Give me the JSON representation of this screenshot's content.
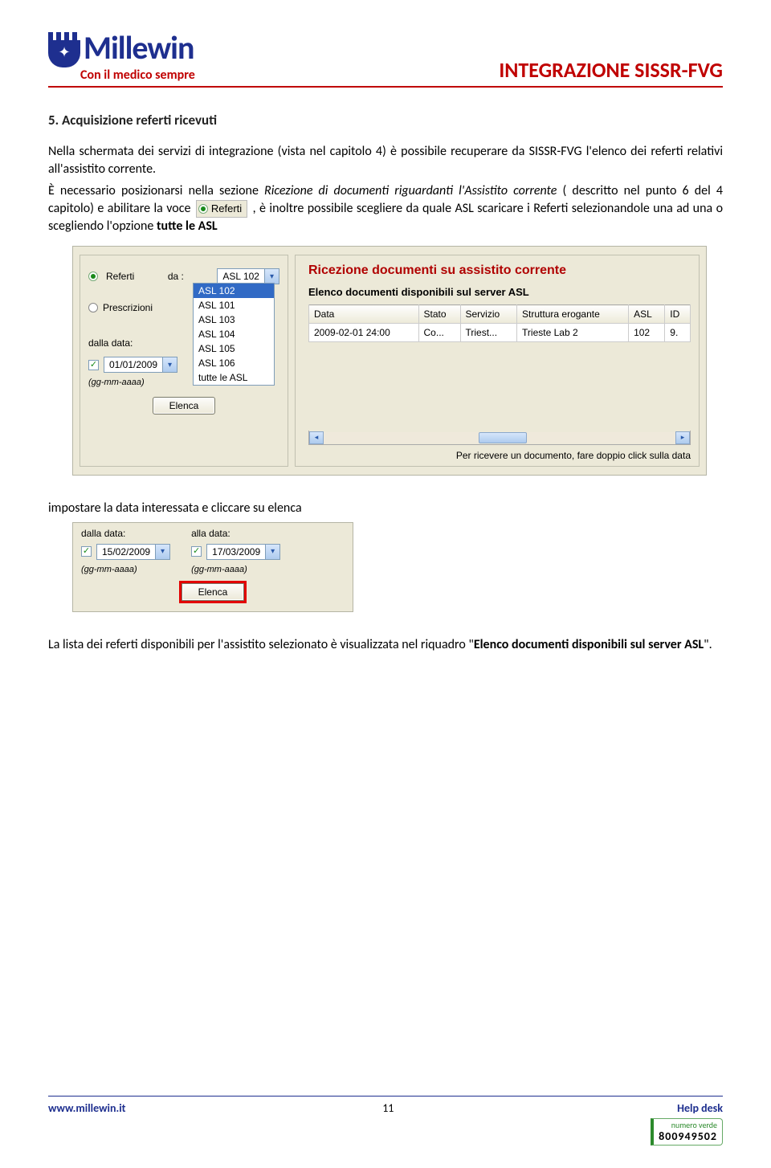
{
  "header": {
    "logo_text": "Millewin",
    "tagline": "Con il medico sempre",
    "title": "INTEGRAZIONE SISSR-FVG"
  },
  "section": {
    "title": "5. Acquisizione referti ricevuti"
  },
  "para1": "Nella schermata dei servizi di integrazione (vista nel capitolo 4) è possibile recuperare da SISSR-FVG l'elenco dei referti relativi all'assistito corrente.",
  "para2a": "È necessario posizionarsi nella sezione ",
  "para2_italic": "Ricezione di documenti riguardanti l'Assistito corrente",
  "para2b": " ( descritto nel punto 6 del 4 capitolo) e abilitare la voce ",
  "para2_radio": "Referti",
  "para2c": ", è inoltre possibile scegliere da quale ASL scaricare i Referti selezionandole una ad una o scegliendo l'opzione ",
  "para2_bold": "tutte le ASL",
  "panel1": {
    "title": "Ricezione documenti su assistito corrente",
    "radio_referti": "Referti",
    "radio_da": "da :",
    "radio_prescrizioni": "Prescrizioni",
    "combo_selected": "ASL 102",
    "list": [
      "ASL 102",
      "ASL 101",
      "ASL 103",
      "ASL 104",
      "ASL 105",
      "ASL 106",
      "tutte le ASL"
    ],
    "dalla_label": "dalla data:",
    "date1": "01/01/2009",
    "hint": "(gg-mm-aaaa)",
    "btn_elenca": "Elenca",
    "right_title": "Elenco documenti disponibili sul server ASL",
    "cols": [
      "Data",
      "Stato",
      "Servizio",
      "Struttura erogante",
      "ASL",
      "ID"
    ],
    "row": [
      "2009-02-01  24:00",
      "Co...",
      "Triest...",
      "Trieste Lab 2",
      "102",
      "9."
    ],
    "footer_note": "Per ricevere un documento, fare doppio click sulla data"
  },
  "mid_text": "impostare la data interessata e cliccare su elenca",
  "panel2": {
    "dalla": "dalla data:",
    "alla": "alla data:",
    "date1": "15/02/2009",
    "date2": "17/03/2009",
    "hint": "(gg-mm-aaaa)",
    "btn": "Elenca"
  },
  "para3a": "La lista dei referti disponibili per l'assistito selezionato è visualizzata nel riquadro \"",
  "para3_bold": "Elenco documenti disponibili sul server ASL",
  "para3b": "\".",
  "footer": {
    "url": "www.millewin.it",
    "page": "11",
    "helpdesk": "Help desk",
    "numero_verde_label": "numero verde",
    "numero_verde": "800949502"
  }
}
